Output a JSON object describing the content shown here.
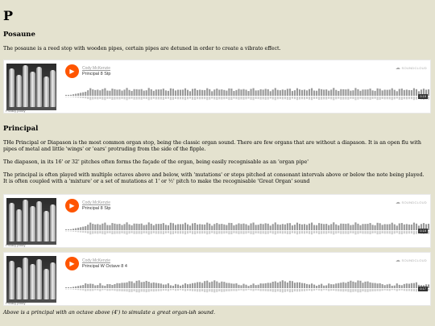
{
  "page_letter": "P",
  "posaune": {
    "heading": "Posaune",
    "text": "The posaune is a reed stop with wooden pipes, certain pipes are detuned in order to create a vibrato effect."
  },
  "principal": {
    "heading": "Principal",
    "para1": "THe Principal or Diapason is the most common organ stop, being the classic organ sound. There are few organs that are without a diapason. It is an open flu with pipes of metal and little 'wings' or 'ears' protruding from the side of the fipple.",
    "para2": "The diapason, in its 16' or 32' pitches often forms the façade of the organ, being easily recognisable as an 'organ pipe'",
    "para3": "The principal is often played with multiple octaves above and below, with 'mutations' or stops pitched at consonant intervals above or below the note being played. It is often coupled with a 'mixture' or a set of mutations at 1' or ½' pitch to make the recognisable 'Great Organ' sound"
  },
  "players": [
    {
      "artist": "Cody McKenzie",
      "track": "Principal 8 Stp",
      "duration": "0:19",
      "privacy": "Privacy policy",
      "brand": "SOUNDCLOUD"
    },
    {
      "artist": "Cody McKenzie",
      "track": "Principal 8 Stp",
      "duration": "0:19",
      "privacy": "Privacy policy",
      "brand": "SOUNDCLOUD"
    },
    {
      "artist": "Cody McKenzie",
      "track": "Principal W Octave 8 4",
      "duration": "0:17",
      "privacy": "Privacy policy",
      "brand": "SOUNDCLOUD"
    }
  ],
  "caption": "Above is a principal with an octave above (4') to simulate a great organ-ish sound.",
  "colors": {
    "accent": "#ff5500",
    "background": "#e4e2cf",
    "waveform": "#999999"
  }
}
